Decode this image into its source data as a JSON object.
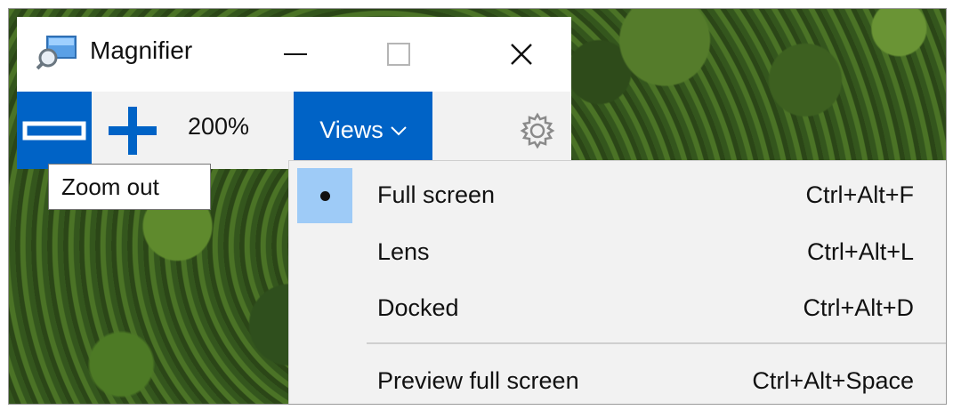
{
  "window": {
    "title": "Magnifier",
    "icon": "magnifier-app-icon",
    "controls": {
      "minimize": "minimize-icon",
      "maximize": "maximize-icon",
      "close": "close-icon"
    }
  },
  "toolbar": {
    "zoom_out_icon": "minus-icon",
    "zoom_in_icon": "plus-icon",
    "zoom_level": "200%",
    "views_label": "Views",
    "settings_icon": "gear-icon"
  },
  "tooltip": {
    "text": "Zoom out"
  },
  "views_menu": {
    "items": [
      {
        "label": "Full screen",
        "shortcut": "Ctrl+Alt+F",
        "selected": true
      },
      {
        "label": "Lens",
        "shortcut": "Ctrl+Alt+L",
        "selected": false
      },
      {
        "label": "Docked",
        "shortcut": "Ctrl+Alt+D",
        "selected": false
      },
      {
        "label": "Preview full screen",
        "shortcut": "Ctrl+Alt+Space",
        "selected": false
      }
    ]
  },
  "colors": {
    "accent": "#0063c6",
    "selection": "#9ecbf7",
    "menu_bg": "#f2f2f2"
  }
}
